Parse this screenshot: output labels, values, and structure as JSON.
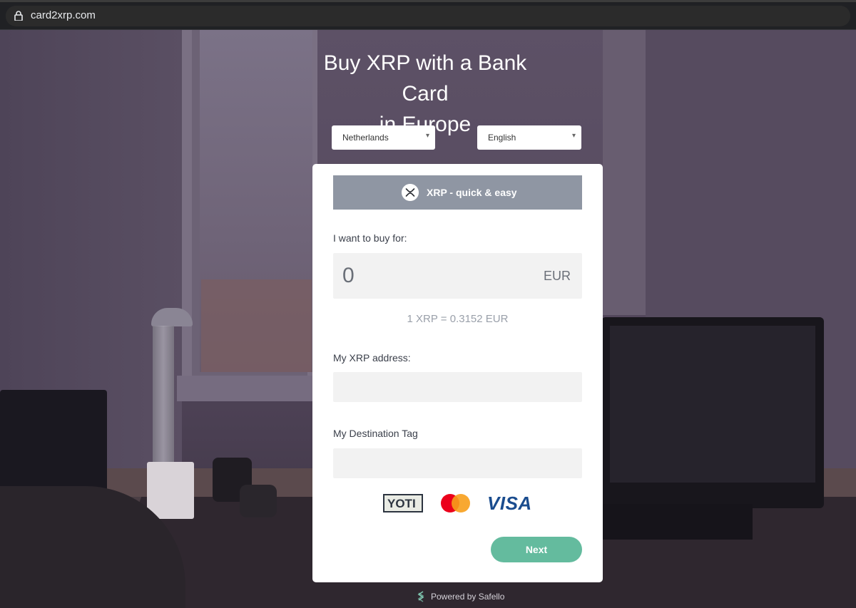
{
  "browser": {
    "url": "card2xrp.com"
  },
  "hero": {
    "title_line1": "Buy XRP with a Bank Card",
    "title_line2": "in Europe"
  },
  "selectors": {
    "country": "Netherlands",
    "language": "English"
  },
  "card": {
    "header_label": "XRP - quick & easy",
    "amount_label": "I want to buy for:",
    "amount_value": "0",
    "amount_currency": "EUR",
    "rate_text": "1 XRP = 0.3152 EUR",
    "address_label": "My XRP address:",
    "address_value": "",
    "tag_label": "My Destination Tag",
    "tag_value": "",
    "payments": {
      "yoti": "YOTI",
      "mastercard_icon": "mastercard-logo",
      "visa": "VISA"
    },
    "next_label": "Next"
  },
  "footer": {
    "powered_by": "Powered by Safello"
  },
  "colors": {
    "accent_green": "#64bb9e",
    "header_gray": "#8f96a3",
    "field_bg": "#f2f2f2",
    "visa_blue": "#1a4c8e",
    "mc_red": "#eb001b",
    "mc_yellow": "#f79e1b"
  }
}
